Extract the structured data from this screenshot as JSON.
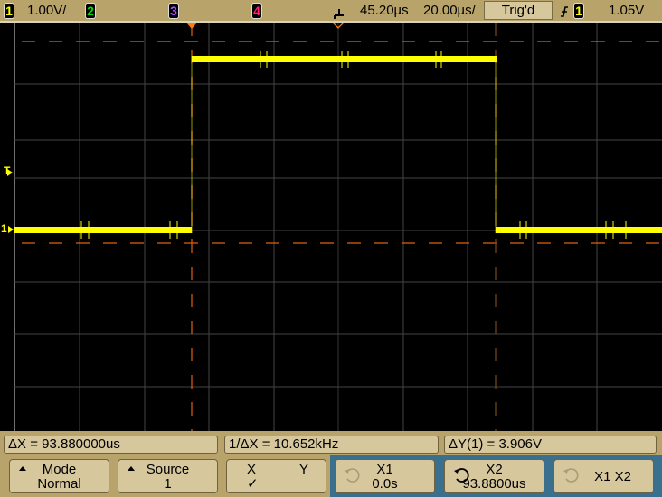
{
  "top_bar": {
    "channels": [
      {
        "label": "1",
        "color": "#ffff00"
      },
      {
        "label": "2",
        "color": "#00e000"
      },
      {
        "label": "3",
        "color": "#b050ff"
      },
      {
        "label": "4",
        "color": "#ff2070"
      }
    ],
    "ch1_scale": "1.00V/",
    "trigger_delay_icon": "trigger-delay-icon",
    "time_delay": "45.20µs",
    "time_scale": "20.00µs/",
    "trigger_status": "Trig'd",
    "trigger_slope_icon": "rising-edge-icon",
    "trigger_source": "1",
    "trigger_level": "1.05V"
  },
  "waveform": {
    "channel": "1",
    "color": "#ffff00",
    "markers": {
      "trigger_level": "T",
      "ch1_ground": "1"
    },
    "signal": "square pulse",
    "low_level_screen_fraction": 0.51,
    "high_level_screen_fraction": 0.09
  },
  "cursors": {
    "color": "#e06010",
    "x1_label": "X1",
    "x2_label": "X2"
  },
  "measurements": {
    "delta_x": "ΔX = 93.880000us",
    "inv_delta_x": "1/ΔX = 10.652kHz",
    "delta_y": "ΔY(1) = 3.906V"
  },
  "softkeys": [
    {
      "line1": "Mode",
      "line2": "Normal",
      "icon": "menu-up-icon"
    },
    {
      "line1": "Source",
      "line2": "1",
      "icon": "menu-up-icon"
    },
    {
      "line1_left": "X",
      "line1_right": "Y",
      "line2": "✓"
    },
    {
      "line1": "X1",
      "line2": "0.0s",
      "icon": "rotate-knob-icon",
      "active": false
    },
    {
      "line1": "X2",
      "line2": "93.8800us",
      "icon": "rotate-knob-icon",
      "active": true
    },
    {
      "line1": "X1 X2",
      "icon": "rotate-knob-icon",
      "active": false
    }
  ]
}
